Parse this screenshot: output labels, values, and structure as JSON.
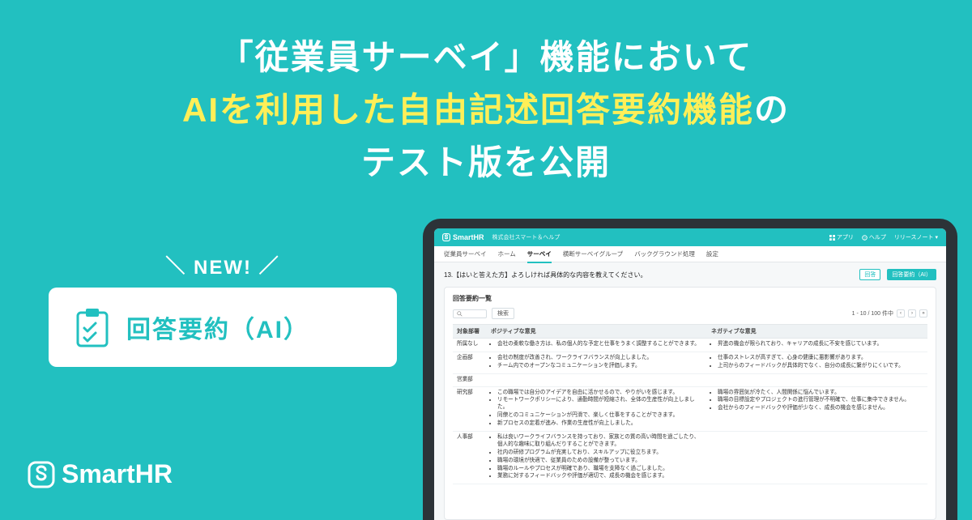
{
  "headline": {
    "line1": "「従業員サーベイ」機能において",
    "line2_accent": "AIを利用した自由記述回答要約機能",
    "line2_suffix": "の",
    "line3": "テスト版を公開"
  },
  "new_label": "NEW!",
  "feature_label": "回答要約（AI）",
  "brand_name": "SmartHR",
  "app": {
    "logo": "SmartHR",
    "org": "株式会社スマート＆ヘルプ",
    "menu_apps": "アプリ",
    "menu_help": "ヘルプ",
    "menu_release": "リリースノート",
    "tabs": [
      "従業員サーベイ",
      "ホーム",
      "サーベイ",
      "横断サーベイグループ",
      "バックグラウンド処理",
      "設定"
    ],
    "active_tab_index": 2,
    "question_title": "13.【はいと答えた方】よろしければ具体的な内容を教えてください。",
    "tab_answers": "回答",
    "tab_summary": "回答要約（AI）",
    "panel_title": "回答要約一覧",
    "search_placeholder": "",
    "refresh_label": "検索",
    "pager_text": "1 - 10 / 100 件中",
    "columns": [
      "対象部署",
      "ポジティブな意見",
      "ネガティブな意見"
    ],
    "rows": [
      {
        "dept": "所属なし",
        "pos": [
          "会社の柔軟な働き方は、私の個人的な予定と仕事をうまく調整することができます。"
        ],
        "neg": [
          "昇進の機会が限られており、キャリアの成長に不安を感じています。"
        ]
      },
      {
        "dept": "企画部",
        "pos": [
          "会社の制度が改善され、ワークライフバランスが向上しました。",
          "チーム内でのオープンなコミュニケーションを評価します。"
        ],
        "neg": [
          "仕事のストレスが高すぎて、心身の健康に悪影響があります。",
          "上司からのフィードバックが具体的でなく、自分の成長に繋がりにくいです。"
        ]
      },
      {
        "dept": "営業部",
        "pos": [],
        "neg": []
      },
      {
        "dept": "研究部",
        "pos": [
          "この職場では自分のアイデアを自由に活かせるので、やりがいを感じます。",
          "リモートワークポリシーにより、通勤時間が短縮され、全体の生産性が向上しました。",
          "同僚とのコミュニケーションが円滑で、楽しく仕事をすることができます。",
          "新プロセスの定着が進み、作業の生産性が向上しました。"
        ],
        "neg": [
          "職場の雰囲気が冷たく、人間関係に悩んでいます。",
          "職場の目標設定やプロジェクトの進行管理が不明確で、仕事に集中できません。",
          "会社からのフィードバックや評価が少なく、成長の機会を感じません。"
        ]
      },
      {
        "dept": "人事部",
        "pos": [
          "私は良いワークライフバランスを持っており、家族との質の高い時間を過ごしたり、個人的な趣味に取り組んだりすることができます。",
          "社内の研修プログラムが充実しており、スキルアップに役立ちます。",
          "職場の環境が快適で、従業員のための設備が整っています。",
          "職場のルールやプロセスが明確であり、職場を支障なく過ごしました。",
          "業務に対するフィードバックや評価が適切で、成長の機会を感じます。"
        ],
        "neg": []
      }
    ]
  }
}
